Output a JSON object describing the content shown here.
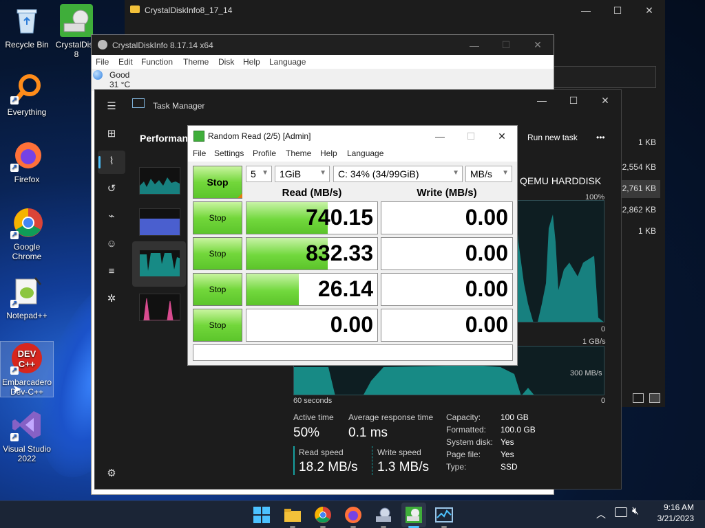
{
  "desktop": {
    "icons": [
      {
        "label": "Recycle Bin"
      },
      {
        "label": "CrystalDisk\n8"
      },
      {
        "label": "Everything"
      },
      {
        "label": "Firefox"
      },
      {
        "label": "Google Chrome"
      },
      {
        "label": "Notepad++"
      },
      {
        "label": "Embarcadero Dev-C++"
      },
      {
        "label": "Visual Studio 2022"
      }
    ]
  },
  "explorer": {
    "title": "CrystalDiskInfo8_17_14",
    "sizes": [
      "1 KB",
      "2,554 KB",
      "2,761 KB",
      "2,862 KB",
      "1 KB"
    ]
  },
  "crystal": {
    "title": "CrystalDiskInfo 8.17.14 x64",
    "menu": [
      "File",
      "Edit",
      "Function",
      "Theme",
      "Disk",
      "Help",
      "Language"
    ],
    "health": "Good",
    "temp": "31 °C"
  },
  "taskman": {
    "title": "Task Manager",
    "section": "Performance",
    "run_new_task": "Run new task",
    "more": "•••",
    "disk_name": "QEMU HARDDISK",
    "pct_label": "100%",
    "zero_top": "0",
    "gbs_label": "1 GB/s",
    "mbs_label": "300 MB/s",
    "seconds_label": "60 seconds",
    "zero_bottom": "0",
    "active_time_label": "Active time",
    "active_time": "50%",
    "avg_response_label": "Average response time",
    "avg_response": "0.1 ms",
    "read_speed_label": "Read speed",
    "read_speed": "18.2 MB/s",
    "write_speed_label": "Write speed",
    "write_speed": "1.3 MB/s",
    "props": [
      {
        "k": "Capacity:",
        "v": "100 GB"
      },
      {
        "k": "Formatted:",
        "v": "100.0 GB"
      },
      {
        "k": "System disk:",
        "v": "Yes"
      },
      {
        "k": "Page file:",
        "v": "Yes"
      },
      {
        "k": "Type:",
        "v": "SSD"
      }
    ]
  },
  "randomread": {
    "title": "Random Read (2/5) [Admin]",
    "menu": [
      "File",
      "Settings",
      "Profile",
      "Theme",
      "Help",
      "Language"
    ],
    "main_button": "Stop",
    "count": "5",
    "size": "1GiB",
    "drive": "C: 34% (34/99GiB)",
    "unit": "MB/s",
    "read_header": "Read (MB/s)",
    "write_header": "Write (MB/s)",
    "rows": [
      {
        "button": "Stop",
        "read": "740.15",
        "write": "0.00",
        "read_fill": 0.62
      },
      {
        "button": "Stop",
        "read": "832.33",
        "write": "0.00",
        "read_fill": 0.62
      },
      {
        "button": "Stop",
        "read": "26.14",
        "write": "0.00",
        "read_fill": 0.4
      },
      {
        "button": "Stop",
        "read": "0.00",
        "write": "0.00",
        "read_fill": 0
      }
    ]
  },
  "taskbar": {
    "time": "9:16 AM",
    "date": "3/21/2023"
  }
}
